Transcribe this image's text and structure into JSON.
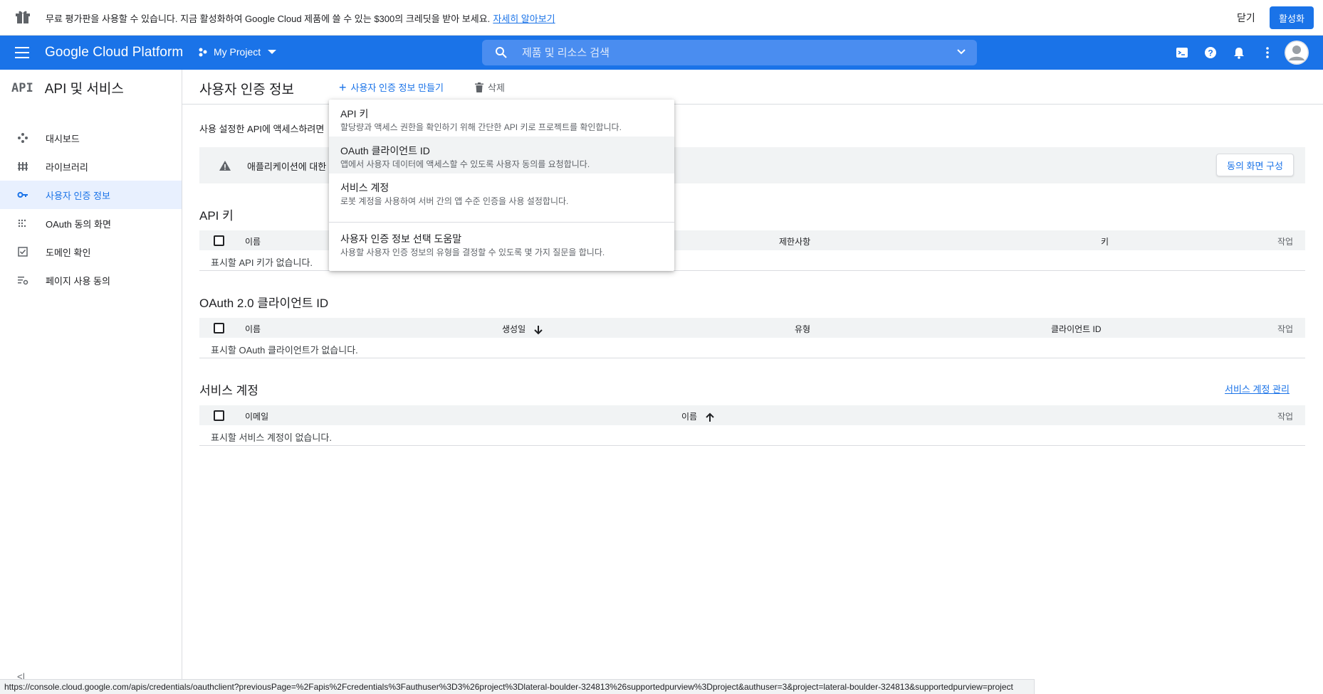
{
  "promo": {
    "text": "무료 평가판을 사용할 수 있습니다. 지금 활성화하여 Google Cloud 제품에 쓸 수 있는 $300의 크레딧을 받아 보세요.",
    "link": "자세히 알아보기",
    "close": "닫기",
    "activate": "활성화"
  },
  "header": {
    "brand": "Google Cloud Platform",
    "project": "My Project",
    "search_placeholder": "제품 및 리소스 검색"
  },
  "sidebar": {
    "logo": "API",
    "title": "API 및 서비스",
    "items": [
      {
        "label": "대시보드",
        "icon": "dashboard-icon"
      },
      {
        "label": "라이브러리",
        "icon": "library-icon"
      },
      {
        "label": "사용자 인증 정보",
        "icon": "key-icon",
        "active": true
      },
      {
        "label": "OAuth 동의 화면",
        "icon": "consent-icon"
      },
      {
        "label": "도메인 확인",
        "icon": "checkbox-icon"
      },
      {
        "label": "페이지 사용 동의",
        "icon": "settings-list-icon"
      }
    ],
    "collapse": "<|"
  },
  "toolbar": {
    "title": "사용자 인증 정보",
    "create": "사용자 인증 정보 만들기",
    "delete": "삭제"
  },
  "main": {
    "intro": "사용 설정한 API에 액세스하려면",
    "warning": "애플리케이션에 대한",
    "consent_button": "동의 화면 구성"
  },
  "api_keys": {
    "title": "API 키",
    "columns": [
      "이름",
      "제한사항",
      "키",
      "작업"
    ],
    "empty": "표시할 API 키가 없습니다."
  },
  "oauth": {
    "title": "OAuth 2.0 클라이언트 ID",
    "columns": [
      "이름",
      "생성일",
      "유형",
      "클라이언트 ID",
      "작업"
    ],
    "empty": "표시할 OAuth 클라이언트가 없습니다."
  },
  "service_accounts": {
    "title": "서비스 계정",
    "manage_link": "서비스 계정 관리",
    "columns": [
      "이메일",
      "이름",
      "작업"
    ],
    "empty": "표시할 서비스 계정이 없습니다."
  },
  "dropdown": {
    "items": [
      {
        "title": "API 키",
        "desc": "할당량과 액세스 권한을 확인하기 위해 간단한 API 키로 프로젝트를 확인합니다."
      },
      {
        "title": "OAuth 클라이언트 ID",
        "desc": "앱에서 사용자 데이터에 액세스할 수 있도록 사용자 동의를 요청합니다."
      },
      {
        "title": "서비스 계정",
        "desc": "로봇 계정을 사용하여 서버 간의 앱 수준 인증을 사용 설정합니다."
      },
      {
        "title": "사용자 인증 정보 선택 도움말",
        "desc": "사용할 사용자 인증 정보의 유형을 결정할 수 있도록 몇 가지 질문을 합니다."
      }
    ]
  },
  "statusbar": {
    "url": "https://console.cloud.google.com/apis/credentials/oauthclient?previousPage=%2Fapis%2Fcredentials%3Fauthuser%3D3%26project%3Dlateral-boulder-324813%26supportedpurview%3Dproject&authuser=3&project=lateral-boulder-324813&supportedpurview=project"
  },
  "colors": {
    "brand_blue": "#1a73e8",
    "sidebar_active_bg": "#e8f0fe",
    "table_header_bg": "#f1f3f4"
  }
}
